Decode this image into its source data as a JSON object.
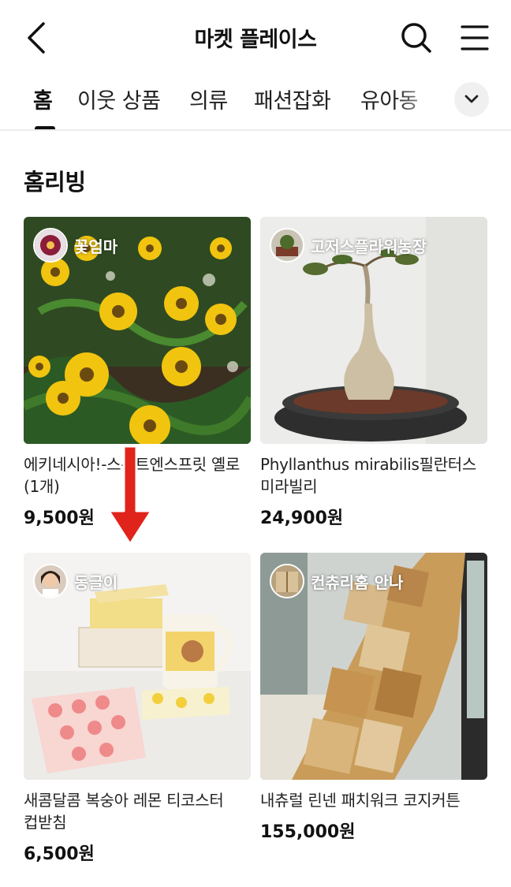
{
  "header": {
    "title": "마켓 플레이스",
    "back_icon": "chevron-left-icon",
    "search_icon": "search-icon",
    "menu_icon": "hamburger-menu-icon"
  },
  "tabs": [
    {
      "label": "홈",
      "active": true
    },
    {
      "label": "이웃 상품",
      "active": false
    },
    {
      "label": "의류",
      "active": false
    },
    {
      "label": "패션잡화",
      "active": false
    },
    {
      "label": "유아동",
      "active": false
    }
  ],
  "tabs_expand_icon": "chevron-down-icon",
  "section": {
    "title": "홈리빙"
  },
  "products": [
    {
      "seller": "꽃엄마",
      "name": "에키네시아!-스위트엔스프릿 옐로(1개)",
      "price": "9,500원"
    },
    {
      "seller": "고저스플라워농장",
      "name": "Phyllanthus mirabilis필란터스 미라빌리",
      "price": "24,900원"
    },
    {
      "seller": "동글이",
      "name": "새콤달콤 복숭아 레몬 티코스터 컵받침",
      "price": "6,500원"
    },
    {
      "seller": "컨츄리홈 안나",
      "name": "내츄럴 린넨 패치워크 코지커튼",
      "price": "155,000원"
    }
  ],
  "colors": {
    "accent": "#e0241b",
    "text": "#111111",
    "muted_bg": "#f0f0f0"
  }
}
